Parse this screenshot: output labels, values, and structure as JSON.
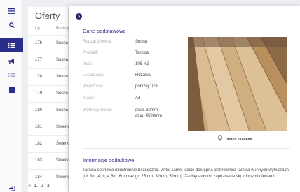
{
  "list": {
    "title": "Oferty",
    "columns": [
      "Lp.",
      "Rodzaj"
    ],
    "rows": [
      {
        "lp": "176",
        "rodzaj": "Sosna"
      },
      {
        "lp": "177",
        "rodzaj": "Sosna"
      },
      {
        "lp": "178",
        "rodzaj": "Sosna"
      },
      {
        "lp": "179",
        "rodzaj": "Sosna"
      },
      {
        "lp": "180",
        "rodzaj": "Sosna"
      },
      {
        "lp": "181",
        "rodzaj": "Świerk"
      },
      {
        "lp": "182",
        "rodzaj": "Świerk"
      },
      {
        "lp": "183",
        "rodzaj": "Świerk"
      },
      {
        "lp": "184",
        "rodzaj": "Świerk"
      }
    ],
    "pager": [
      "«",
      "1",
      "2",
      "3"
    ]
  },
  "modal": {
    "section_basic": "Dane podstawowe",
    "fields": [
      {
        "label": "Rodzaj drewna:",
        "value": "Sosna"
      },
      {
        "label": "Produkt:",
        "value": "Tarcica"
      },
      {
        "label": "Ilość:",
        "value": "105 m3"
      },
      {
        "label": "Lokalizacja:",
        "value": "Rdzawa"
      },
      {
        "label": "Wilgotność:",
        "value": "poniżej 10%"
      },
      {
        "label": "Klasa:",
        "value": "A/I"
      },
      {
        "label": "Wymiary cięcia:",
        "value": "grub. 32mm;",
        "value2": "dług. 4500mm"
      }
    ],
    "section_extra": "Informacje dodatkowe",
    "description": "Tarcica sosnowa obustronnie bezsęczna. W tej samej klasie dostępna jest również tarcica w innych wymiarach (dł. 3m, 4,m, 4,5m, 6m oraz gr. 25mm, 32mm, 52mm). Zachęcamy do zapoznania się z innymi ofertami.",
    "logo_text": "TIMBER TRADERS"
  },
  "colors": {
    "accent": "#2b2d8c",
    "sidebar_bg": "#fafafb"
  }
}
